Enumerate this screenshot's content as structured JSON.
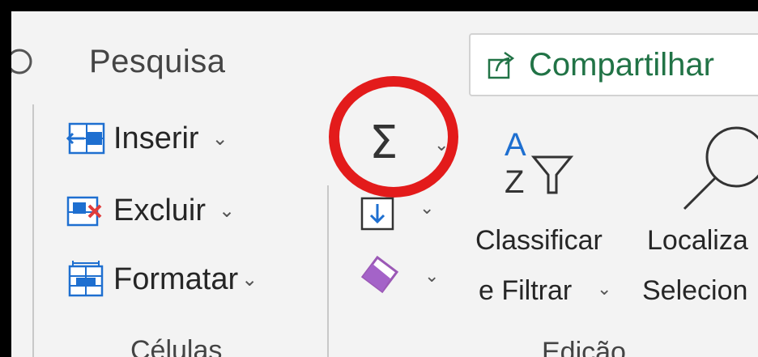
{
  "search": {
    "label": "Pesquisa"
  },
  "share": {
    "label": "Compartilhar"
  },
  "cells_group": {
    "commands": [
      {
        "label": "Inserir",
        "icon": "insert-cells-icon"
      },
      {
        "label": "Excluir",
        "icon": "delete-cells-icon"
      },
      {
        "label": "Formatar",
        "icon": "format-cells-icon"
      }
    ],
    "group_label": "Células"
  },
  "editing_group": {
    "autosum_icon": "autosum-sigma-icon",
    "fill_icon": "fill-down-icon",
    "clear_icon": "eraser-icon",
    "sort_filter": {
      "line1": "Classificar",
      "line2": "e Filtrar"
    },
    "find_select": {
      "line1": "Localiza",
      "line2": "Selecion"
    },
    "group_label": "Edição",
    "highlight_color": "#e31b1b"
  },
  "colors": {
    "accent_green": "#217346",
    "ribbon_bg": "#f3f3f3",
    "frame": "#000000"
  }
}
